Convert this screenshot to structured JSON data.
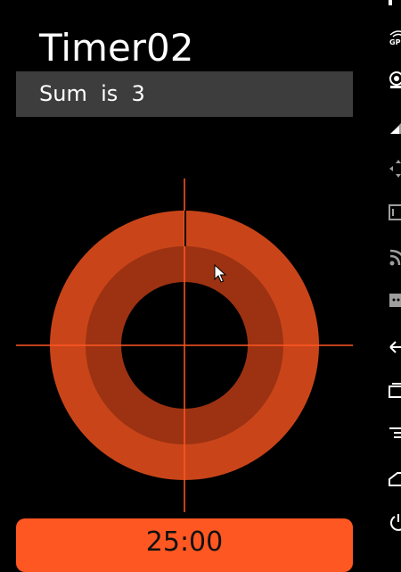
{
  "app": {
    "title": "Timer02",
    "sum_text": "Sum  is  3",
    "timer_value": "25:00"
  },
  "colors": {
    "background": "#000000",
    "sum_bar": "#3d3d3d",
    "outer_ring": "#c94519",
    "inner_ring": "#9c3212",
    "crosshair": "#ff5722",
    "button": "#ff5722"
  },
  "side_toolbar": {
    "icons": [
      "gps-icon",
      "camera-icon",
      "battery-icon",
      "dpad-icon",
      "id-icon",
      "wifi-icon",
      "sms-icon",
      "back-icon",
      "recents-icon",
      "menu-icon",
      "home-icon",
      "power-icon"
    ],
    "gps_label": "GPS"
  }
}
